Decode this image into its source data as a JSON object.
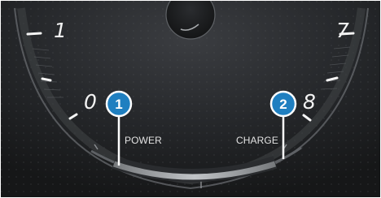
{
  "gauge": {
    "scale_labels": {
      "left_top": "1",
      "left_bottom": "0",
      "right_top": "7",
      "right_bottom": "8"
    },
    "zone_labels": {
      "power": "POWER",
      "charge": "CHARGE"
    }
  },
  "callouts": [
    {
      "number": "1"
    },
    {
      "number": "2"
    }
  ],
  "colors": {
    "callout_fill": "#1f7fc0",
    "background": "#1f2022",
    "needle": "#ffffff"
  }
}
